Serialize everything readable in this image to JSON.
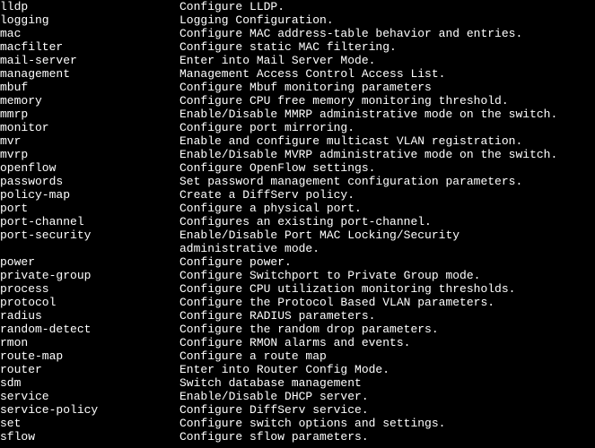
{
  "rows": [
    {
      "cmd": "lldp",
      "desc": "Configure LLDP."
    },
    {
      "cmd": "logging",
      "desc": "Logging Configuration."
    },
    {
      "cmd": "mac",
      "desc": "Configure MAC address-table behavior and entries."
    },
    {
      "cmd": "macfilter",
      "desc": "Configure static MAC filtering."
    },
    {
      "cmd": "mail-server",
      "desc": "Enter into Mail Server Mode."
    },
    {
      "cmd": "management",
      "desc": "Management Access Control Access List."
    },
    {
      "cmd": "mbuf",
      "desc": "Configure Mbuf monitoring parameters"
    },
    {
      "cmd": "memory",
      "desc": "Configure CPU free memory monitoring threshold."
    },
    {
      "cmd": "mmrp",
      "desc": "Enable/Disable MMRP administrative mode on the switch."
    },
    {
      "cmd": "monitor",
      "desc": "Configure port mirroring."
    },
    {
      "cmd": "mvr",
      "desc": "Enable and configure multicast VLAN registration."
    },
    {
      "cmd": "mvrp",
      "desc": "Enable/Disable MVRP administrative mode on the switch."
    },
    {
      "cmd": "openflow",
      "desc": "Configure OpenFlow settings."
    },
    {
      "cmd": "passwords",
      "desc": "Set password management configuration parameters."
    },
    {
      "cmd": "policy-map",
      "desc": "Create a DiffServ policy."
    },
    {
      "cmd": "port",
      "desc": "Configure a physical port."
    },
    {
      "cmd": "port-channel",
      "desc": "Configures an existing port-channel."
    },
    {
      "cmd": "port-security",
      "desc": "Enable/Disable Port MAC Locking/Security"
    },
    {
      "cmd": "",
      "desc": "administrative mode."
    },
    {
      "cmd": "power",
      "desc": "Configure power."
    },
    {
      "cmd": "private-group",
      "desc": "Configure Switchport to Private Group mode."
    },
    {
      "cmd": "process",
      "desc": "Configure CPU utilization monitoring thresholds."
    },
    {
      "cmd": "protocol",
      "desc": "Configure the Protocol Based VLAN parameters."
    },
    {
      "cmd": "radius",
      "desc": "Configure RADIUS parameters."
    },
    {
      "cmd": "random-detect",
      "desc": "Configure the random drop parameters."
    },
    {
      "cmd": "rmon",
      "desc": "Configure RMON alarms and events."
    },
    {
      "cmd": "route-map",
      "desc": "Configure a route map"
    },
    {
      "cmd": "router",
      "desc": "Enter into Router Config Mode."
    },
    {
      "cmd": "sdm",
      "desc": "Switch database management"
    },
    {
      "cmd": "service",
      "desc": "Enable/Disable DHCP server."
    },
    {
      "cmd": "service-policy",
      "desc": "Configure DiffServ service."
    },
    {
      "cmd": "set",
      "desc": "Configure switch options and settings."
    },
    {
      "cmd": "sflow",
      "desc": "Configure sflow parameters."
    }
  ]
}
